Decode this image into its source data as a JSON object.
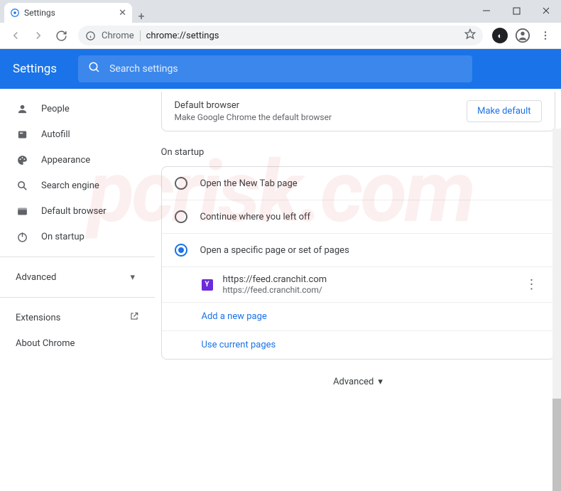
{
  "window": {
    "tab_title": "Settings",
    "min": "—",
    "max": "☐",
    "close": "✕"
  },
  "toolbar": {
    "chip": "Chrome",
    "url": "chrome://settings"
  },
  "app": {
    "title": "Settings",
    "search_placeholder": "Search settings"
  },
  "sidebar": {
    "items": [
      {
        "icon": "person",
        "label": "People"
      },
      {
        "icon": "autofill",
        "label": "Autofill"
      },
      {
        "icon": "palette",
        "label": "Appearance"
      },
      {
        "icon": "search",
        "label": "Search engine"
      },
      {
        "icon": "browser",
        "label": "Default browser"
      },
      {
        "icon": "power",
        "label": "On startup"
      }
    ],
    "advanced": "Advanced",
    "extensions": "Extensions",
    "about": "About Chrome"
  },
  "default_browser": {
    "title": "Default browser",
    "sub": "Make Google Chrome the default browser",
    "btn": "Make default"
  },
  "startup": {
    "title": "On startup",
    "options": [
      "Open the New Tab page",
      "Continue where you left off",
      "Open a specific page or set of pages"
    ],
    "page_title": "https://feed.cranchit.com",
    "page_url": "https://feed.cranchit.com/",
    "add_new": "Add a new page",
    "use_current": "Use current pages"
  },
  "advanced_bottom": "Advanced",
  "watermark": "pcrisk.com"
}
